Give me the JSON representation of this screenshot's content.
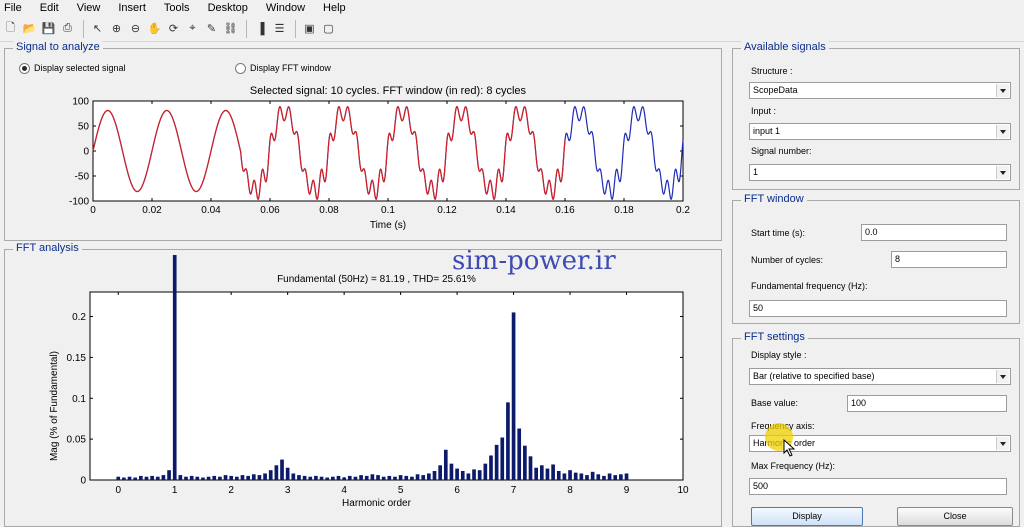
{
  "menu": [
    "File",
    "Edit",
    "View",
    "Insert",
    "Tools",
    "Desktop",
    "Window",
    "Help"
  ],
  "toolbar_icons": [
    "new-file-icon",
    "open-folder-icon",
    "save-icon",
    "print-icon",
    "pointer-icon",
    "zoom-in-icon",
    "zoom-out-icon",
    "pan-icon",
    "rotate-icon",
    "data-cursor-icon",
    "brush-icon",
    "link-icon",
    "colorbar-icon",
    "legend-icon",
    "hide-tools-icon",
    "show-tools-icon"
  ],
  "signal_panel": {
    "title": "Signal to analyze",
    "radio_selected": "Display selected signal",
    "radio_fft": "Display FFT window",
    "plot_title": "Selected signal: 10 cycles. FFT window (in red): 8 cycles",
    "xlabel": "Time (s)",
    "xticks": [
      "0",
      "0.02",
      "0.04",
      "0.06",
      "0.08",
      "0.1",
      "0.12",
      "0.14",
      "0.16",
      "0.18",
      "0.2"
    ],
    "yticks": [
      "100",
      "50",
      "0",
      "-50",
      "-100"
    ]
  },
  "fft_panel": {
    "title": "FFT analysis",
    "plot_title": "Fundamental (50Hz) = 81.19 , THD= 25.61%",
    "xlabel": "Harmonic order",
    "ylabel": "Mag (% of Fundamental)",
    "xticks": [
      "0",
      "1",
      "2",
      "3",
      "4",
      "5",
      "6",
      "7",
      "8",
      "9",
      "10"
    ],
    "yticks": [
      "0.2",
      "0.15",
      "0.1",
      "0.05",
      "0"
    ]
  },
  "watermark": "sim-power.ir",
  "available_signals": {
    "title": "Available signals",
    "structure_label": "Structure :",
    "structure_value": "ScopeData",
    "input_label": "Input :",
    "input_value": "input 1",
    "signal_number_label": "Signal number:",
    "signal_number_value": "1"
  },
  "fft_window": {
    "title": "FFT window",
    "start_time_label": "Start time (s):",
    "start_time_value": "0.0",
    "cycles_label": "Number of cycles:",
    "cycles_value": "8",
    "fund_freq_label": "Fundamental frequency (Hz):",
    "fund_freq_value": "50"
  },
  "fft_settings": {
    "title": "FFT settings",
    "display_style_label": "Display style :",
    "display_style_value": "Bar (relative to specified base)",
    "base_value_label": "Base value:",
    "base_value": "100",
    "freq_axis_label": "Frequency axis:",
    "freq_axis_value": "Harmonic order",
    "max_freq_label": "Max Frequency (Hz):",
    "max_freq_value": "500"
  },
  "buttons": {
    "display": "Display",
    "close": "Close"
  },
  "chart_data": [
    {
      "type": "line",
      "title": "Selected signal: 10 cycles. FFT window (in red): 8 cycles",
      "xlabel": "Time (s)",
      "ylabel": "",
      "xlim": [
        0,
        0.2
      ],
      "ylim": [
        -100,
        100
      ],
      "grid": false,
      "series": [
        {
          "color": "#1f2ab5",
          "x_range": [
            0,
            0.2
          ],
          "description_fundamental_amplitude": 81.19
        },
        {
          "color": "#d62020",
          "x_range": [
            0,
            0.16
          ]
        }
      ]
    },
    {
      "type": "bar",
      "title": "Fundamental (50Hz) = 81.19 , THD= 25.61%",
      "xlabel": "Harmonic order",
      "ylabel": "Mag (% of Fundamental)",
      "xlim": [
        -0.5,
        10
      ],
      "ylim": [
        0,
        0.23
      ],
      "color": "#0c1a6b",
      "x": [
        0,
        0.1,
        0.2,
        0.3,
        0.4,
        0.5,
        0.6,
        0.7,
        0.8,
        0.9,
        1,
        1.1,
        1.2,
        1.3,
        1.4,
        1.5,
        1.6,
        1.7,
        1.8,
        1.9,
        2,
        2.1,
        2.2,
        2.3,
        2.4,
        2.5,
        2.6,
        2.7,
        2.8,
        2.9,
        3,
        3.1,
        3.2,
        3.3,
        3.4,
        3.5,
        3.6,
        3.7,
        3.8,
        3.9,
        4,
        4.1,
        4.2,
        4.3,
        4.4,
        4.5,
        4.6,
        4.7,
        4.8,
        4.9,
        5,
        5.1,
        5.2,
        5.3,
        5.4,
        5.5,
        5.6,
        5.7,
        5.8,
        5.9,
        6,
        6.1,
        6.2,
        6.3,
        6.4,
        6.5,
        6.6,
        6.7,
        6.8,
        6.9,
        7,
        7.1,
        7.2,
        7.3,
        7.4,
        7.5,
        7.6,
        7.7,
        7.8,
        7.9,
        8,
        8.1,
        8.2,
        8.3,
        8.4,
        8.5,
        8.6,
        8.7,
        8.8,
        8.9,
        9
      ],
      "values": [
        0.004,
        0.003,
        0.004,
        0.003,
        0.005,
        0.004,
        0.005,
        0.004,
        0.006,
        0.012,
        1.0,
        0.006,
        0.004,
        0.005,
        0.004,
        0.003,
        0.004,
        0.005,
        0.004,
        0.006,
        0.005,
        0.004,
        0.006,
        0.005,
        0.007,
        0.006,
        0.008,
        0.012,
        0.018,
        0.025,
        0.015,
        0.008,
        0.006,
        0.005,
        0.004,
        0.005,
        0.004,
        0.003,
        0.004,
        0.005,
        0.003,
        0.005,
        0.004,
        0.006,
        0.005,
        0.007,
        0.006,
        0.004,
        0.005,
        0.004,
        0.006,
        0.005,
        0.004,
        0.007,
        0.006,
        0.008,
        0.011,
        0.018,
        0.037,
        0.02,
        0.014,
        0.011,
        0.008,
        0.013,
        0.012,
        0.02,
        0.03,
        0.043,
        0.052,
        0.095,
        0.205,
        0.063,
        0.042,
        0.029,
        0.015,
        0.018,
        0.014,
        0.019,
        0.011,
        0.008,
        0.012,
        0.009,
        0.008,
        0.006,
        0.01,
        0.007,
        0.005,
        0.008,
        0.006,
        0.007,
        0.008
      ]
    }
  ]
}
